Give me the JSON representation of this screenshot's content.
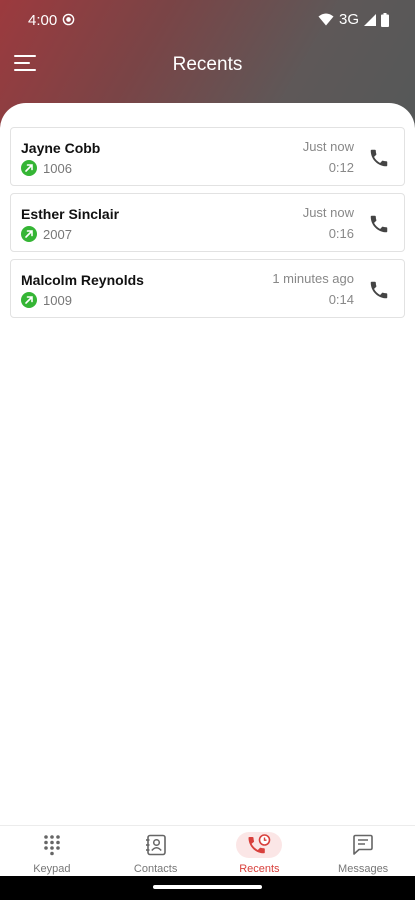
{
  "status": {
    "time": "4:00",
    "network": "3G"
  },
  "appbar": {
    "title": "Recents"
  },
  "recents": [
    {
      "name": "Jayne Cobb",
      "number": "1006",
      "when": "Just now",
      "duration": "0:12",
      "direction": "outgoing"
    },
    {
      "name": "Esther Sinclair",
      "number": "2007",
      "when": "Just now",
      "duration": "0:16",
      "direction": "outgoing"
    },
    {
      "name": "Malcolm Reynolds",
      "number": "1009",
      "when": "1 minutes ago",
      "duration": "0:14",
      "direction": "outgoing"
    }
  ],
  "nav": [
    {
      "label": "Keypad",
      "icon": "keypad-icon"
    },
    {
      "label": "Contacts",
      "icon": "contacts-icon"
    },
    {
      "label": "Recents",
      "icon": "recents-icon",
      "active": true
    },
    {
      "label": "Messages",
      "icon": "messages-icon"
    }
  ],
  "colors": {
    "accent": "#d8403c",
    "outgoing": "#35b535"
  }
}
